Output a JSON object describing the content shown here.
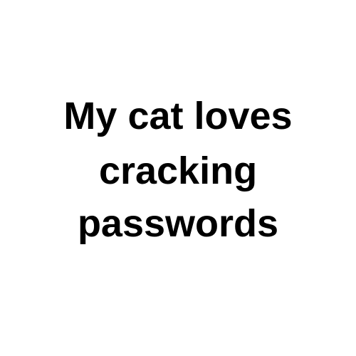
{
  "text": {
    "lines": [
      "My cat loves",
      "cracking",
      "passwords"
    ]
  },
  "colors": {
    "background": "#ffffff",
    "text": "#000000"
  }
}
